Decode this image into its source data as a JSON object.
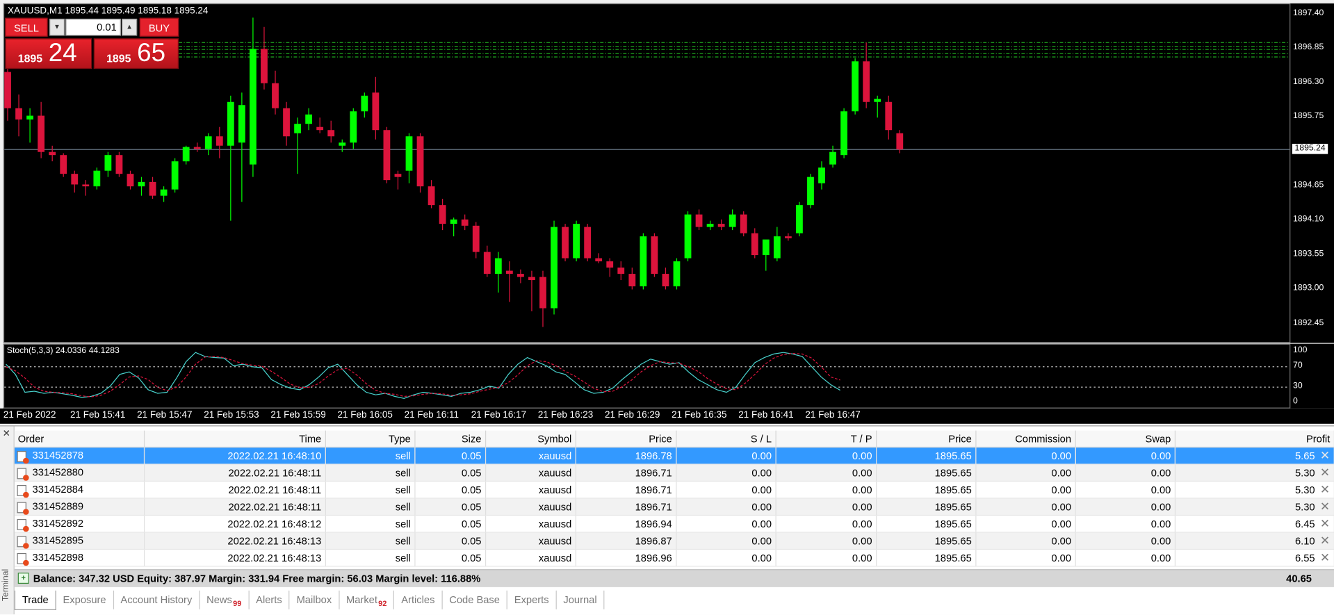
{
  "chart": {
    "title": "XAUUSD,M1  1895.44 1895.49 1895.18 1895.24",
    "current_price": "1895.24",
    "price_labels": [
      "1897.40",
      "1896.85",
      "1896.30",
      "1895.75",
      "1894.65",
      "1894.10",
      "1893.55",
      "1893.00",
      "1892.45"
    ],
    "time_labels": [
      "21 Feb 2022",
      "21 Feb 15:41",
      "21 Feb 15:47",
      "21 Feb 15:53",
      "21 Feb 15:59",
      "21 Feb 16:05",
      "21 Feb 16:11",
      "21 Feb 16:17",
      "21 Feb 16:23",
      "21 Feb 16:29",
      "21 Feb 16:35",
      "21 Feb 16:41",
      "21 Feb 16:47"
    ],
    "bull_color": "#00ff00",
    "bear_color": "#dc143c",
    "candles": [
      [
        1896.48,
        1896.55,
        1895.7,
        1895.9
      ],
      [
        1895.9,
        1896.12,
        1895.45,
        1895.72
      ],
      [
        1895.72,
        1895.9,
        1895.35,
        1895.78
      ],
      [
        1895.78,
        1896.0,
        1895.1,
        1895.2
      ],
      [
        1895.2,
        1895.3,
        1895.05,
        1895.15
      ],
      [
        1895.15,
        1895.18,
        1894.8,
        1894.85
      ],
      [
        1894.85,
        1894.9,
        1894.55,
        1894.68
      ],
      [
        1894.68,
        1894.75,
        1894.5,
        1894.65
      ],
      [
        1894.65,
        1894.95,
        1894.6,
        1894.9
      ],
      [
        1894.9,
        1895.2,
        1894.8,
        1895.15
      ],
      [
        1895.15,
        1895.2,
        1894.8,
        1894.85
      ],
      [
        1894.85,
        1894.9,
        1894.6,
        1894.65
      ],
      [
        1894.65,
        1894.8,
        1894.5,
        1894.72
      ],
      [
        1894.72,
        1894.8,
        1894.45,
        1894.5
      ],
      [
        1894.5,
        1894.65,
        1894.4,
        1894.6
      ],
      [
        1894.6,
        1895.1,
        1894.55,
        1895.05
      ],
      [
        1895.05,
        1895.3,
        1895.0,
        1895.28
      ],
      [
        1895.28,
        1895.35,
        1895.2,
        1895.25
      ],
      [
        1895.25,
        1895.5,
        1895.15,
        1895.45
      ],
      [
        1895.45,
        1895.6,
        1895.1,
        1895.3
      ],
      [
        1895.3,
        1896.1,
        1894.1,
        1896.0
      ],
      [
        1895.35,
        1896.15,
        1894.4,
        1895.95
      ],
      [
        1895.0,
        1897.35,
        1894.8,
        1896.85
      ],
      [
        1896.85,
        1897.2,
        1896.2,
        1896.3
      ],
      [
        1896.3,
        1896.5,
        1895.8,
        1895.9
      ],
      [
        1895.9,
        1896.0,
        1895.3,
        1895.45
      ],
      [
        1895.5,
        1895.75,
        1894.85,
        1895.65
      ],
      [
        1895.65,
        1895.9,
        1895.55,
        1895.8
      ],
      [
        1895.6,
        1895.75,
        1895.5,
        1895.55
      ],
      [
        1895.55,
        1895.7,
        1895.35,
        1895.45
      ],
      [
        1895.3,
        1895.4,
        1895.2,
        1895.35
      ],
      [
        1895.35,
        1895.9,
        1895.25,
        1895.85
      ],
      [
        1895.85,
        1896.15,
        1895.75,
        1896.1
      ],
      [
        1896.15,
        1896.4,
        1895.4,
        1895.55
      ],
      [
        1895.55,
        1895.6,
        1894.7,
        1894.75
      ],
      [
        1894.85,
        1894.9,
        1894.6,
        1894.8
      ],
      [
        1894.9,
        1895.5,
        1894.7,
        1895.45
      ],
      [
        1895.45,
        1895.5,
        1894.55,
        1894.65
      ],
      [
        1894.65,
        1894.75,
        1894.3,
        1894.35
      ],
      [
        1894.35,
        1894.45,
        1893.95,
        1894.05
      ],
      [
        1894.05,
        1894.15,
        1893.85,
        1894.12
      ],
      [
        1894.12,
        1894.2,
        1893.95,
        1894.02
      ],
      [
        1894.02,
        1894.08,
        1893.5,
        1893.6
      ],
      [
        1893.6,
        1893.7,
        1893.2,
        1893.25
      ],
      [
        1893.25,
        1893.6,
        1892.95,
        1893.5
      ],
      [
        1893.3,
        1893.45,
        1892.8,
        1893.25
      ],
      [
        1893.25,
        1893.32,
        1893.1,
        1893.2
      ],
      [
        1893.2,
        1893.3,
        1892.65,
        1893.15
      ],
      [
        1893.2,
        1893.3,
        1892.4,
        1892.7
      ],
      [
        1892.7,
        1894.1,
        1892.6,
        1894.0
      ],
      [
        1894.0,
        1894.05,
        1893.45,
        1893.5
      ],
      [
        1893.5,
        1894.1,
        1893.45,
        1894.05
      ],
      [
        1894.0,
        1894.05,
        1893.45,
        1893.5
      ],
      [
        1893.5,
        1893.58,
        1893.42,
        1893.45
      ],
      [
        1893.45,
        1893.5,
        1893.2,
        1893.35
      ],
      [
        1893.35,
        1893.45,
        1893.15,
        1893.25
      ],
      [
        1893.25,
        1893.35,
        1893.0,
        1893.05
      ],
      [
        1893.05,
        1893.9,
        1893.0,
        1893.85
      ],
      [
        1893.85,
        1893.9,
        1893.2,
        1893.25
      ],
      [
        1893.25,
        1893.35,
        1893.0,
        1893.05
      ],
      [
        1893.05,
        1893.5,
        1893.0,
        1893.45
      ],
      [
        1893.5,
        1894.25,
        1893.45,
        1894.2
      ],
      [
        1894.2,
        1894.28,
        1893.95,
        1894.0
      ],
      [
        1894.0,
        1894.1,
        1893.95,
        1894.05
      ],
      [
        1894.05,
        1894.12,
        1893.95,
        1894.0
      ],
      [
        1894.0,
        1894.28,
        1893.95,
        1894.2
      ],
      [
        1894.2,
        1894.25,
        1893.85,
        1893.9
      ],
      [
        1893.9,
        1893.98,
        1893.5,
        1893.55
      ],
      [
        1893.55,
        1893.6,
        1893.3,
        1893.8
      ],
      [
        1893.5,
        1894.0,
        1893.45,
        1893.85
      ],
      [
        1893.85,
        1893.9,
        1893.78,
        1893.82
      ],
      [
        1893.9,
        1894.4,
        1893.85,
        1894.35
      ],
      [
        1894.35,
        1894.85,
        1894.3,
        1894.8
      ],
      [
        1894.7,
        1895.05,
        1894.6,
        1894.95
      ],
      [
        1895.0,
        1895.3,
        1894.95,
        1895.2
      ],
      [
        1895.15,
        1895.9,
        1895.1,
        1895.85
      ],
      [
        1895.85,
        1896.7,
        1895.8,
        1896.65
      ],
      [
        1896.65,
        1896.95,
        1895.9,
        1896.0
      ],
      [
        1896.0,
        1896.1,
        1895.75,
        1896.05
      ],
      [
        1896.0,
        1896.1,
        1895.4,
        1895.55
      ],
      [
        1895.5,
        1895.55,
        1895.18,
        1895.24
      ]
    ],
    "tp_levels": [
      1896.95,
      1896.89,
      1896.84,
      1896.78,
      1896.72
    ]
  },
  "stochastic": {
    "title": "Stoch(5,3,3) 24.0336 44.1283",
    "levels_labels": [
      "100",
      "70",
      "30",
      "0"
    ],
    "main_color": "#48d1cc",
    "signal_color": "#dc143c",
    "main": [
      75,
      55,
      20,
      22,
      18,
      20,
      17,
      14,
      10,
      12,
      18,
      32,
      55,
      60,
      48,
      25,
      18,
      20,
      48,
      80,
      98,
      90,
      88,
      87,
      72,
      75,
      70,
      68,
      45,
      35,
      28,
      25,
      35,
      50,
      68,
      75,
      55,
      35,
      20,
      15,
      18,
      12,
      8,
      15,
      20,
      18,
      15,
      12,
      18,
      20,
      25,
      32,
      28,
      55,
      75,
      88,
      80,
      72,
      60,
      55,
      40,
      25,
      18,
      20,
      28,
      45,
      60,
      75,
      85,
      80,
      75,
      78,
      60,
      45,
      35,
      25,
      20,
      30,
      55,
      78,
      88,
      95,
      98,
      95,
      90,
      70,
      50,
      35,
      24
    ],
    "signal": [
      70,
      62,
      48,
      30,
      22,
      20,
      19,
      17,
      13,
      11,
      14,
      22,
      35,
      50,
      52,
      45,
      30,
      23,
      30,
      50,
      75,
      89,
      90,
      88,
      82,
      76,
      73,
      71,
      61,
      49,
      36,
      29,
      30,
      37,
      52,
      64,
      67,
      54,
      37,
      24,
      18,
      16,
      12,
      13,
      16,
      18,
      17,
      14,
      15,
      17,
      22,
      26,
      30,
      39,
      54,
      72,
      82,
      80,
      72,
      61,
      52,
      40,
      28,
      21,
      22,
      31,
      44,
      60,
      72,
      80,
      78,
      77,
      70,
      61,
      47,
      36,
      27,
      25,
      38,
      55,
      74,
      87,
      94,
      96,
      95,
      87,
      70,
      50,
      44
    ]
  },
  "trade_panel": {
    "sell_label": "SELL",
    "buy_label": "BUY",
    "lot": "0.01",
    "bid_small": "1895",
    "bid_big": "24",
    "ask_small": "1895",
    "ask_big": "65"
  },
  "terminal": {
    "side_label": "Terminal",
    "columns": [
      "Order",
      "Time",
      "Type",
      "Size",
      "Symbol",
      "Price",
      "S / L",
      "T / P",
      "Price",
      "Commission",
      "Swap",
      "Profit"
    ],
    "orders": [
      {
        "order": "331452878",
        "time": "2022.02.21 16:48:10",
        "type": "sell",
        "size": "0.05",
        "symbol": "xauusd",
        "price": "1896.78",
        "sl": "0.00",
        "tp": "0.00",
        "cur_price": "1895.65",
        "commission": "0.00",
        "swap": "0.00",
        "profit": "5.65"
      },
      {
        "order": "331452880",
        "time": "2022.02.21 16:48:11",
        "type": "sell",
        "size": "0.05",
        "symbol": "xauusd",
        "price": "1896.71",
        "sl": "0.00",
        "tp": "0.00",
        "cur_price": "1895.65",
        "commission": "0.00",
        "swap": "0.00",
        "profit": "5.30"
      },
      {
        "order": "331452884",
        "time": "2022.02.21 16:48:11",
        "type": "sell",
        "size": "0.05",
        "symbol": "xauusd",
        "price": "1896.71",
        "sl": "0.00",
        "tp": "0.00",
        "cur_price": "1895.65",
        "commission": "0.00",
        "swap": "0.00",
        "profit": "5.30"
      },
      {
        "order": "331452889",
        "time": "2022.02.21 16:48:11",
        "type": "sell",
        "size": "0.05",
        "symbol": "xauusd",
        "price": "1896.71",
        "sl": "0.00",
        "tp": "0.00",
        "cur_price": "1895.65",
        "commission": "0.00",
        "swap": "0.00",
        "profit": "5.30"
      },
      {
        "order": "331452892",
        "time": "2022.02.21 16:48:12",
        "type": "sell",
        "size": "0.05",
        "symbol": "xauusd",
        "price": "1896.94",
        "sl": "0.00",
        "tp": "0.00",
        "cur_price": "1895.65",
        "commission": "0.00",
        "swap": "0.00",
        "profit": "6.45"
      },
      {
        "order": "331452895",
        "time": "2022.02.21 16:48:13",
        "type": "sell",
        "size": "0.05",
        "symbol": "xauusd",
        "price": "1896.87",
        "sl": "0.00",
        "tp": "0.00",
        "cur_price": "1895.65",
        "commission": "0.00",
        "swap": "0.00",
        "profit": "6.10"
      },
      {
        "order": "331452898",
        "time": "2022.02.21 16:48:13",
        "type": "sell",
        "size": "0.05",
        "symbol": "xauusd",
        "price": "1896.96",
        "sl": "0.00",
        "tp": "0.00",
        "cur_price": "1895.65",
        "commission": "0.00",
        "swap": "0.00",
        "profit": "6.55"
      }
    ],
    "summary": "Balance: 347.32 USD  Equity: 387.97  Margin: 331.94  Free margin: 56.03  Margin level: 116.88%",
    "total_profit": "40.65",
    "tabs": [
      {
        "label": "Trade",
        "badge": ""
      },
      {
        "label": "Exposure",
        "badge": ""
      },
      {
        "label": "Account History",
        "badge": ""
      },
      {
        "label": "News",
        "badge": "99"
      },
      {
        "label": "Alerts",
        "badge": ""
      },
      {
        "label": "Mailbox",
        "badge": ""
      },
      {
        "label": "Market",
        "badge": "92"
      },
      {
        "label": "Articles",
        "badge": ""
      },
      {
        "label": "Code Base",
        "badge": ""
      },
      {
        "label": "Experts",
        "badge": ""
      },
      {
        "label": "Journal",
        "badge": ""
      }
    ],
    "active_tab": "Trade"
  }
}
